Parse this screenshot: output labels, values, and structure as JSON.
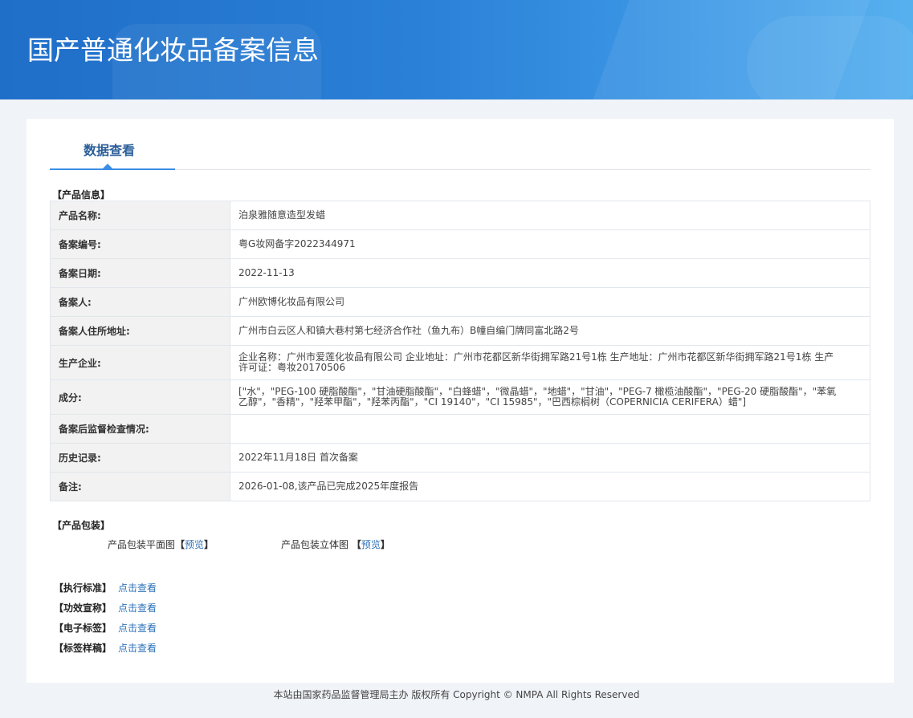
{
  "header": {
    "title": "国产普通化妆品备案信息"
  },
  "tab": {
    "label": "数据查看"
  },
  "product_info": {
    "title": "【产品信息】",
    "rows": [
      {
        "label": "产品名称:",
        "value": "泊泉雅随意造型发蜡"
      },
      {
        "label": "备案编号:",
        "value": "粤G妆网备字2022344971"
      },
      {
        "label": "备案日期:",
        "value": "2022-11-13"
      },
      {
        "label": "备案人:",
        "value": "广州欧博化妆品有限公司"
      },
      {
        "label": "备案人住所地址:",
        "value": "广州市白云区人和镇大巷村第七经济合作社（鱼九布）B幢自编门牌同富北路2号"
      },
      {
        "label": "生产企业:",
        "value": "企业名称：广州市爱莲化妆品有限公司 企业地址：广州市花都区新华街拥军路21号1栋 生产地址：广州市花都区新华街拥军路21号1栋 生产许可证：粤妆20170506"
      },
      {
        "label": "成分:",
        "value": "[\"水\"，\"PEG-100 硬脂酸酯\"，\"甘油硬脂酸酯\"，\"白蜂蜡\"，\"微晶蜡\"，\"地蜡\"，\"甘油\"，\"PEG-7 橄榄油酸酯\"，\"PEG-20 硬脂酸酯\"，\"苯氧乙醇\"，\"香精\"，\"羟苯甲酯\"，\"羟苯丙酯\"，\"CI 19140\"，\"CI 15985\"，\"巴西棕榈树（COPERNICIA CERIFERA）蜡\"]"
      },
      {
        "label": "备案后监督检查情况:",
        "value": ""
      },
      {
        "label": "历史记录:",
        "value": "2022年11月18日 首次备案"
      },
      {
        "label": "备注:",
        "value": "2026-01-08,该产品已完成2025年度报告"
      }
    ]
  },
  "packaging": {
    "title": "【产品包装】",
    "flat": {
      "label": "产品包装平面图",
      "open": "【",
      "link": "预览",
      "close": "】"
    },
    "solid": {
      "label": "产品包装立体图",
      "open": "【",
      "link": "预览",
      "close": "】"
    }
  },
  "standards": [
    {
      "label": "【执行标准】",
      "link": "点击查看"
    },
    {
      "label": "【功效宣称】",
      "link": "点击查看"
    },
    {
      "label": "【电子标签】",
      "link": "点击查看"
    },
    {
      "label": "【标签样稿】",
      "link": "点击查看"
    }
  ],
  "footer": {
    "text": "本站由国家药品监督管理局主办 版权所有 Copyright © NMPA All Rights Reserved"
  }
}
